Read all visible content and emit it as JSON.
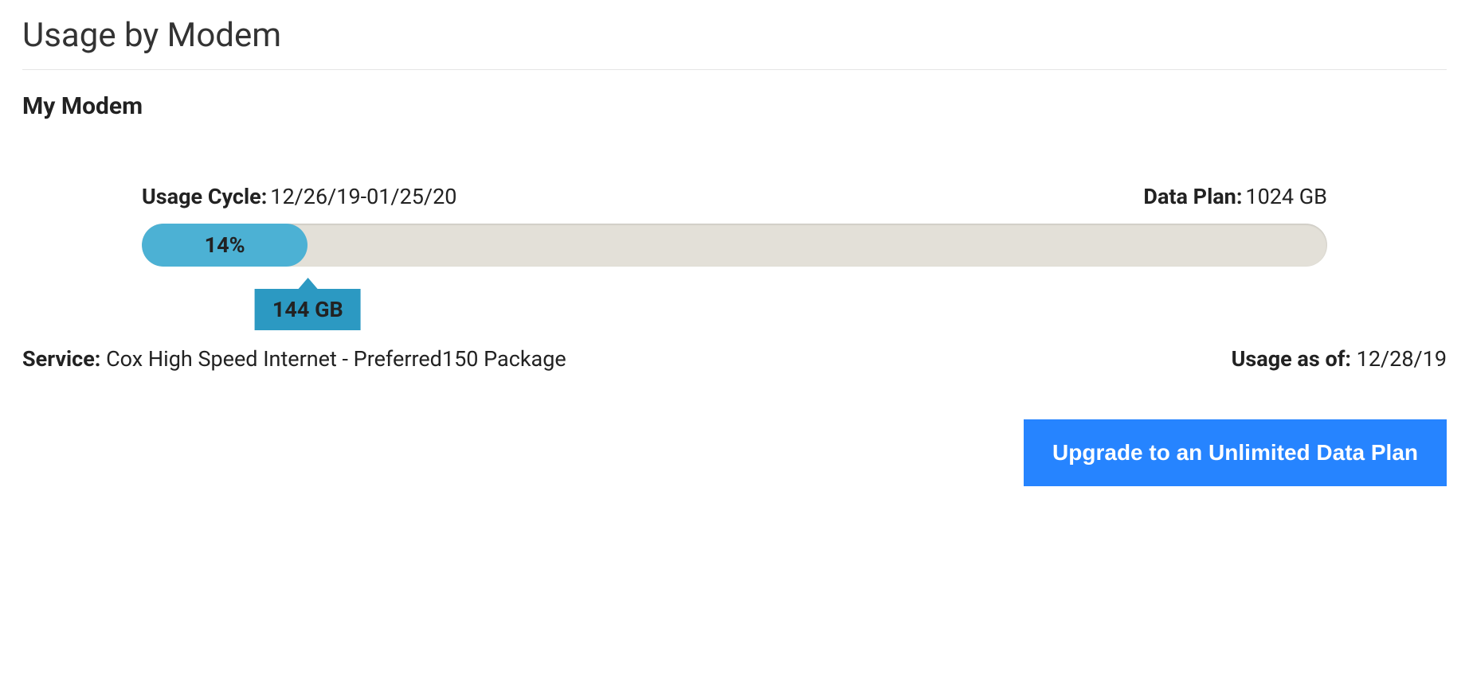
{
  "page": {
    "title": "Usage by Modem",
    "modem_title": "My Modem"
  },
  "usage": {
    "cycle_label": "Usage Cycle:",
    "cycle_value": "12/26/19-01/25/20",
    "data_plan_label": "Data Plan:",
    "data_plan_value": "1024 GB",
    "percent_text": "14%",
    "percent_num": 14,
    "used_text": "144 GB"
  },
  "service": {
    "label": "Service:",
    "value": "Cox High Speed Internet - Preferred150 Package",
    "asof_label": "Usage as of:",
    "asof_value": "12/28/19"
  },
  "actions": {
    "upgrade_label": "Upgrade to an Unlimited Data Plan"
  },
  "chart_data": {
    "type": "bar",
    "title": "Usage by Modem",
    "categories": [
      "Used"
    ],
    "values": [
      144
    ],
    "unit": "GB",
    "max": 1024,
    "percent": 14,
    "xlabel": "",
    "ylabel": "",
    "ylim": [
      0,
      1024
    ]
  }
}
